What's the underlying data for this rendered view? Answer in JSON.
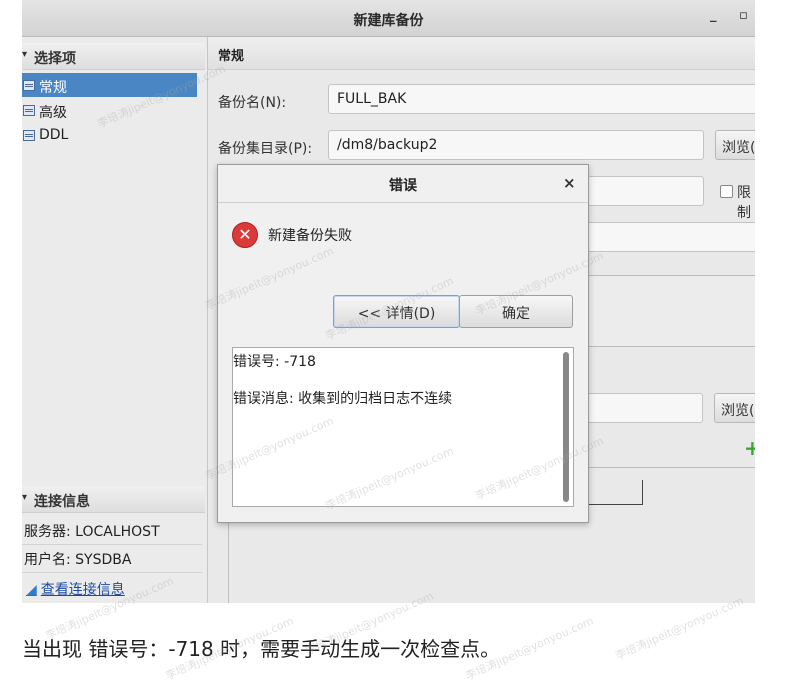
{
  "window": {
    "title": "新建库备份",
    "min_glyph": "_",
    "max_glyph": "▫"
  },
  "sidebar": {
    "select_header": "选择项",
    "items": [
      {
        "label": "常规",
        "selected": true
      },
      {
        "label": "高级",
        "selected": false
      },
      {
        "label": "DDL",
        "selected": false
      }
    ],
    "connection_header": "连接信息",
    "server": "服务器: LOCALHOST",
    "user": "用户名: SYSDBA",
    "view_link": "查看连接信息"
  },
  "main": {
    "section_title": "常规",
    "backup_name_label": "备份名(N):",
    "backup_name_value": "FULL_BAK",
    "backup_dir_label": "备份集目录(P):",
    "backup_dir_value": "/dm8/backup2",
    "browse_label_1": "浏览(",
    "limit_label": "限制",
    "browse_label_2": "浏览(",
    "add_glyph": "+",
    "remove_glyph": "-"
  },
  "dialog": {
    "title": "错误",
    "close_glyph": "×",
    "message": "新建备份失败",
    "details_button": "<< 详情(D)",
    "ok_button": "确定",
    "error_code_line": "错误号:   -718",
    "error_message_line": "错误消息: 收集到的归档日志不连续"
  },
  "caption": "当出现  错误号：-718 时，需要手动生成一次检查点。",
  "watermark": "李培涛jipeit@yonyou.com",
  "colors": {
    "selection": "#4a86c4",
    "error_red": "#d93b3b",
    "link": "#1d49a6",
    "add_green": "#3aa43a"
  }
}
